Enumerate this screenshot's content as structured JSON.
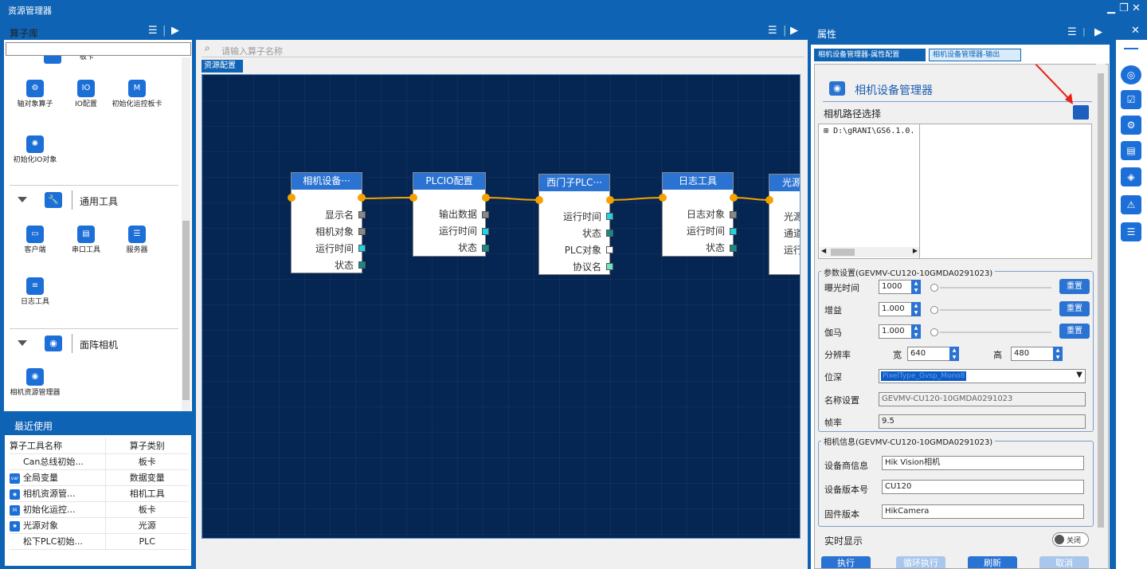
{
  "window": {
    "title": "资源管理器"
  },
  "left_panel": {
    "title": "算子库",
    "tools_top": [
      {
        "label": "轴对象算子",
        "icon": "axis-icon"
      },
      {
        "label": "IO配置",
        "icon": "io-icon"
      },
      {
        "label": "初始化运控板卡",
        "icon": "motion-card-icon"
      },
      {
        "label": "初始化IO对象",
        "icon": "io-init-icon"
      }
    ],
    "partial_category": "板卡",
    "categories": [
      {
        "label": "通用工具",
        "icon": "wrench-icon"
      },
      {
        "label": "面阵相机",
        "icon": "camera-icon"
      }
    ],
    "general_tools": [
      {
        "label": "客户端",
        "icon": "client-icon"
      },
      {
        "label": "串口工具",
        "icon": "serial-icon"
      },
      {
        "label": "服务器",
        "icon": "server-icon"
      },
      {
        "label": "日志工具",
        "icon": "log-icon"
      }
    ],
    "camera_tools": [
      {
        "label": "相机资源管理器",
        "icon": "camera-manager-icon"
      }
    ]
  },
  "recent": {
    "title": "最近使用",
    "headers": [
      "算子工具名称",
      "算子类别"
    ],
    "rows": [
      {
        "name": "Can总线初始...",
        "type": "板卡",
        "icon": ""
      },
      {
        "name": "全局变量",
        "type": "数据变量",
        "icon": "var"
      },
      {
        "name": "相机资源管...",
        "type": "相机工具",
        "icon": "cam"
      },
      {
        "name": "初始化运控...",
        "type": "板卡",
        "icon": "mc"
      },
      {
        "name": "光源对象",
        "type": "光源",
        "icon": "light"
      },
      {
        "name": "松下PLC初始...",
        "type": "PLC",
        "icon": ""
      }
    ]
  },
  "center": {
    "search_placeholder": "请输入算子名称",
    "tab": "资源配置",
    "nodes": [
      {
        "title": "相机设备···",
        "ports": [
          "显示名",
          "相机对象",
          "运行时间",
          "状态"
        ]
      },
      {
        "title": "PLCIO配置",
        "ports": [
          "输出数据",
          "运行时间",
          "状态"
        ]
      },
      {
        "title": "西门子PLC···",
        "ports": [
          "运行时间",
          "状态",
          "PLC对象",
          "协议名"
        ]
      },
      {
        "title": "日志工具",
        "ports": [
          "日志对象",
          "运行时间",
          "状态"
        ]
      },
      {
        "title": "光源",
        "ports": [
          "光源",
          "通道",
          "运行"
        ]
      }
    ]
  },
  "properties": {
    "title": "属性",
    "tabs": [
      "相机设备管理器-属性配置",
      "相机设备管理器-输出"
    ],
    "heading": "相机设备管理器",
    "path_label": "相机路径选择",
    "tree_item": "D:\\gRANI\\GS6.1.0.",
    "param_section": "参数设置(GEVMV-CU120-10GMDA0291023)",
    "exposure_label": "曝光时间",
    "exposure_value": "1000",
    "gain_label": "增益",
    "gain_value": "1.000",
    "gamma_label": "伽马",
    "gamma_value": "1.000",
    "reset_label": "重置",
    "resolution_label": "分辨率",
    "width_label": "宽",
    "width_value": "640",
    "height_label": "高",
    "height_value": "480",
    "bitdepth_label": "位深",
    "bitdepth_value": "PixelType_Gvsp_Mono8",
    "name_label": "名称设置",
    "name_value": "GEVMV-CU120-10GMDA0291023",
    "fps_label": "帧率",
    "fps_value": "9.5",
    "info_section": "相机信息(GEVMV-CU120-10GMDA0291023)",
    "vendor_label": "设备商信息",
    "vendor_value": "Hik Vision相机",
    "version_label": "设备版本号",
    "version_value": "CU120",
    "firmware_label": "固件版本",
    "firmware_value": "HikCamera",
    "realtime_label": "实时显示",
    "toggle_label": "关闭",
    "bottom_buttons": [
      "执行",
      "循环执行",
      "刷新",
      "取消"
    ]
  },
  "colors": {
    "accent": "#0f63b5",
    "canvas": "#052552",
    "node_header": "#2b73d2",
    "link": "#f5a100"
  }
}
